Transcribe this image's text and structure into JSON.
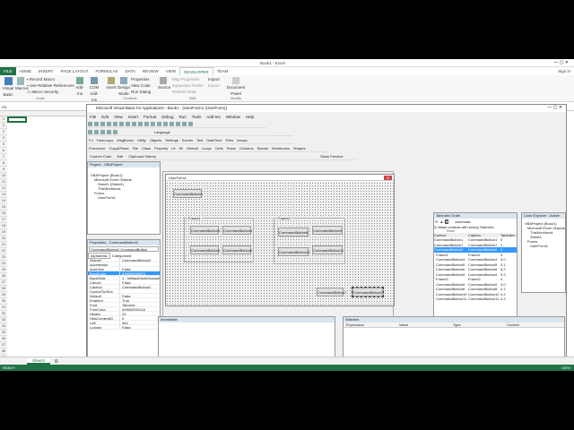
{
  "excel": {
    "title": "Book1 - Excel",
    "tabs": [
      "FILE",
      "HOME",
      "INSERT",
      "PAGE LAYOUT",
      "FORMULAS",
      "DATA",
      "REVIEW",
      "VIEW",
      "DEVELOPER",
      "TEAM"
    ],
    "signin": "Sign in",
    "ribbon": {
      "visual_basic": "Visual Basic",
      "macros": "Macros",
      "record_macro": "Record Macro",
      "relative_refs": "Use Relative References",
      "macro_security": "Macro Security",
      "code_group": "Code",
      "addins": "Add-Ins",
      "com_addins": "COM Add-Ins",
      "insert": "Insert",
      "design_mode": "Design Mode",
      "properties": "Properties",
      "view_code": "View Code",
      "run_dialog": "Run Dialog",
      "controls_group": "Controls",
      "source": "Source",
      "map_properties": "Map Properties",
      "expansion_packs": "Expansion Packs",
      "refresh_data": "Refresh Data",
      "import": "Import",
      "export": "Export",
      "xml_group": "XML",
      "document_panel": "Document Panel",
      "modify_group": "Modify"
    },
    "name_box": "A1",
    "sheet_tab": "Sheet1",
    "status": "READY",
    "zoom": "100%"
  },
  "vbe": {
    "title": "Microsoft Visual Basic for Applications - Book1 - [UserForm1 (UserForm)]",
    "menu": [
      "File",
      "Edit",
      "View",
      "Insert",
      "Format",
      "Debug",
      "Run",
      "Tools",
      "Add-Ins",
      "Window",
      "Help"
    ],
    "toolbar_custom": "Custom Code",
    "toolbar_edit": "Edit",
    "toolbar_clipboard": "Clipboard History",
    "toolbar_show_preview": "Show Preview",
    "toolbar_items": [
      "Procedure",
      "Copy&Paste",
      "File",
      "Class",
      "Property",
      "Lit",
      "Wi",
      "Default"
    ],
    "toolbar2_items": [
      "Loops",
      "Cells",
      "Rows",
      "Columns",
      "Sheets",
      "Workbooks",
      "Shapes"
    ],
    "toolbar3_items": [
      "Fn",
      "FastLoops",
      "MsgBoxes",
      "Utility",
      "Objects",
      "Settings"
    ],
    "toolbar4_items": [
      "Events",
      "Text",
      "DateTime",
      "Files",
      "Arrays"
    ],
    "language": "Language",
    "project": {
      "title": "Project - VBAProject",
      "root": "VBAProject (Book1)",
      "folder1": "Microsoft Excel Objects",
      "sheet": "Sheet1 (Sheet1)",
      "workbook": "ThisWorkbook",
      "folder2": "Forms",
      "form": "UserForm1"
    },
    "properties": {
      "title": "Properties - CommandButton2",
      "object": "CommandButton2  CommandButton",
      "tab_alpha": "Alphabetic",
      "tab_cat": "Categorized",
      "rows": [
        [
          "(Name)",
          "CommandButton2"
        ],
        [
          "Accelerator",
          ""
        ],
        [
          "AutoSize",
          "False"
        ],
        [
          "BackColor",
          "&H8000000F&"
        ],
        [
          "BackStyle",
          "1 - fmBackStyleOpaque"
        ],
        [
          "Cancel",
          "False"
        ],
        [
          "Caption",
          "CommandButton2"
        ],
        [
          "ControlTipText",
          ""
        ],
        [
          "Default",
          "False"
        ],
        [
          "Enabled",
          "True"
        ],
        [
          "Font",
          "Tahoma"
        ],
        [
          "ForeColor",
          "&H80000012&"
        ],
        [
          "Height",
          "24"
        ],
        [
          "HelpContextID",
          "0"
        ],
        [
          "Left",
          "462"
        ],
        [
          "Locked",
          "False"
        ]
      ]
    },
    "userform": {
      "title": "UserForm1",
      "btn1": "CommandButton1",
      "frame1": "Frame1",
      "frame2": "Frame2",
      "f1_buttons": [
        "CommandButton3",
        "CommandButton4",
        "CommandButton5",
        "CommandButton6"
      ],
      "f2_buttons": [
        "CommandButton8",
        "CommandButton9",
        "CommandButton10",
        "CommandButton11"
      ],
      "btn7": "CommandButton7",
      "btn2": "CommandButton2"
    },
    "immediate": "Immediate",
    "watches": {
      "title": "Watches",
      "cols": [
        "Expression",
        "Value",
        "Type",
        "Context"
      ]
    },
    "tab_order": {
      "title": "Tabindex Order",
      "automatic": "Automatic",
      "mask": "Mask controls with wrong TabIndex",
      "down": "Down",
      "cols": [
        "Control",
        "Caption",
        "TabIndex"
      ],
      "rows": [
        [
          "CommandButton1",
          "CommandButton1",
          "0"
        ],
        [
          "CommandButton7",
          "CommandButton7",
          "1"
        ],
        [
          "CommandButton2",
          "CommandButton2",
          "2"
        ],
        [
          "Frame1",
          "Frame1",
          "3"
        ],
        [
          "CommandButton4",
          "CommandButton4",
          "3.0"
        ],
        [
          "CommandButton5",
          "CommandButton5",
          "3.1"
        ],
        [
          "CommandButton6",
          "CommandButton6",
          "3.2"
        ],
        [
          "CommandButton3",
          "CommandButton3",
          "3.3"
        ],
        [
          "Frame2",
          "Frame2",
          "4"
        ],
        [
          "CommandButton9",
          "CommandButton9",
          "4.0"
        ],
        [
          "CommandButton8",
          "CommandButton8",
          "4.1"
        ],
        [
          "CommandButton10",
          "CommandButton10",
          "4.2"
        ],
        [
          "CommandButton11",
          "CommandButton11",
          "4.3"
        ]
      ]
    },
    "code_explorer": {
      "title": "Code Explorer - Active",
      "root": "VBAProject (Book1)",
      "n1": "Microsoft Excel Objects",
      "n2": "ThisWorkbook",
      "n3": "Sheet1",
      "n4": "Forms",
      "n5": "UserForm1"
    }
  }
}
